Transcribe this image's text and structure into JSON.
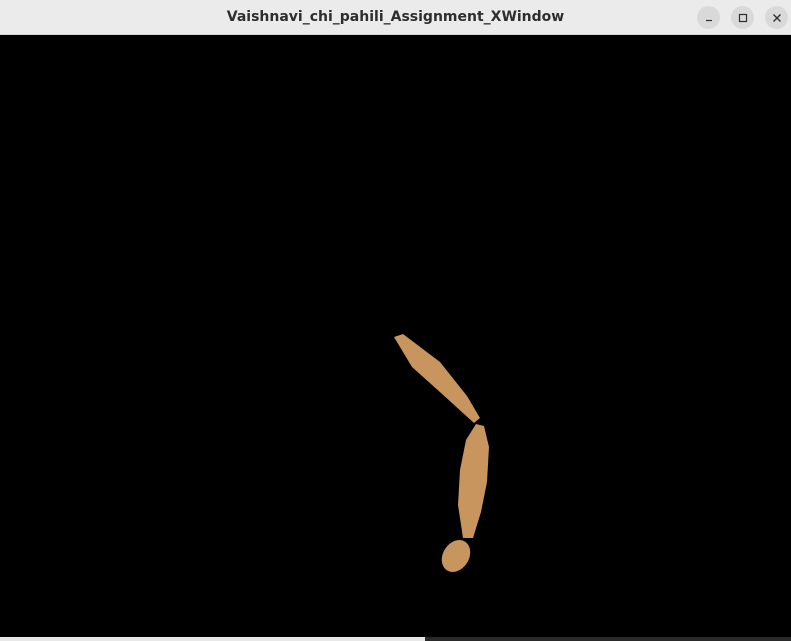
{
  "window": {
    "title": "Vaishnavi_chi_pahili_Assignment_XWindow"
  },
  "controls": {
    "minimize_icon": "minimize-icon",
    "maximize_icon": "maximize-icon",
    "close_icon": "close-icon"
  },
  "colors": {
    "titlebar_bg": "#ebebeb",
    "canvas_bg": "#000000",
    "shape_fill": "#c8955f"
  }
}
